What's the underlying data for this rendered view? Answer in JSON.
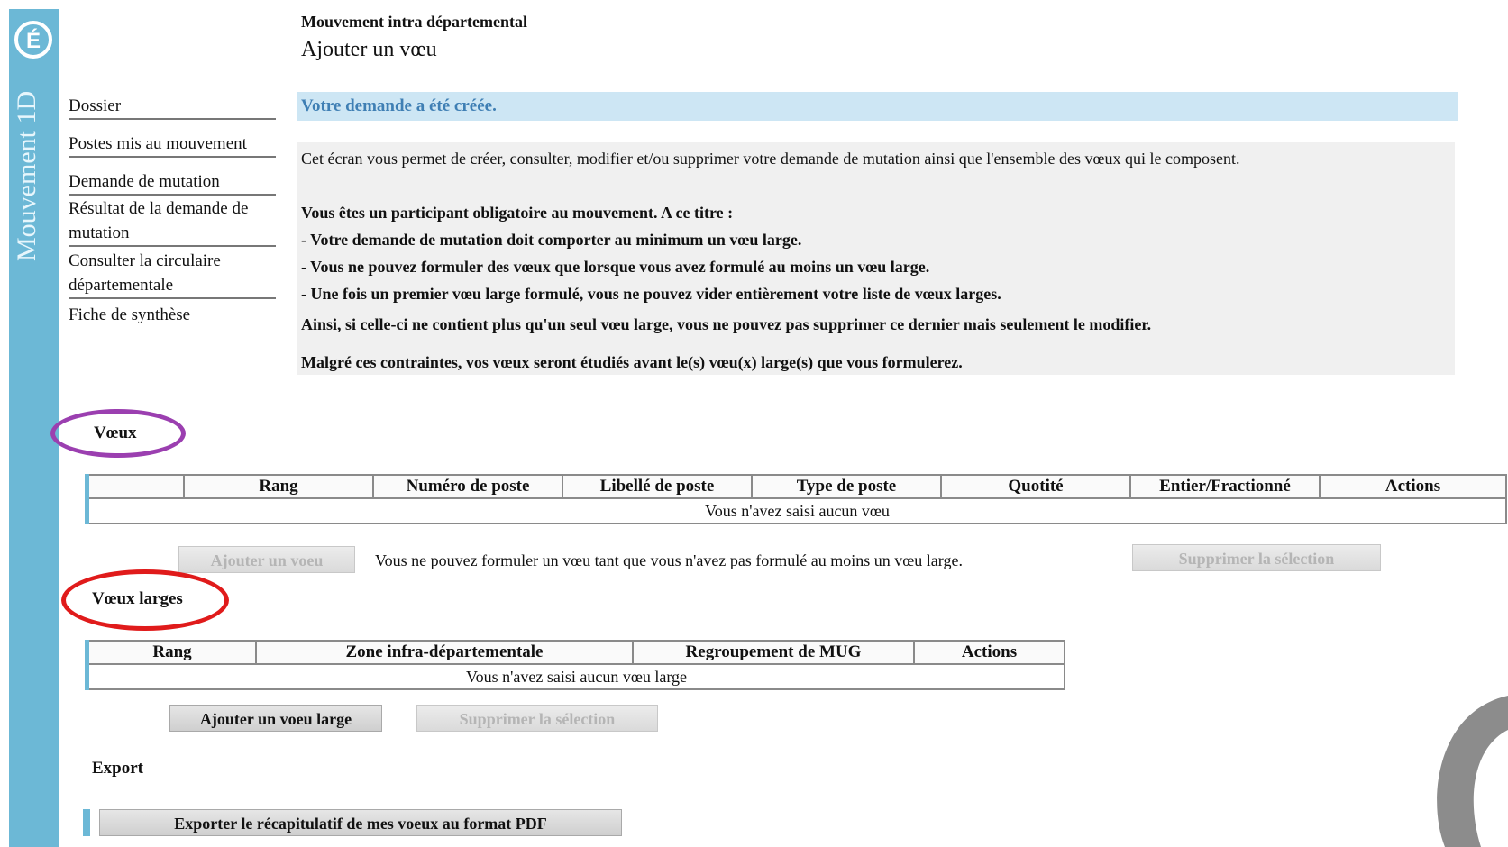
{
  "app": {
    "vertical_title": "Mouvement 1D",
    "logo_letter": "É"
  },
  "menu": {
    "items": [
      "Dossier",
      "Postes mis au mouvement",
      "Demande de mutation",
      "Résultat de la demande de mutation",
      "Consulter la circulaire départementale",
      "Fiche de synthèse"
    ]
  },
  "header": {
    "subtitle": "Mouvement intra départemental",
    "title": "Ajouter un vœu"
  },
  "success_message": "Votre demande a été créée.",
  "info": {
    "intro": "Cet écran vous permet de créer, consulter, modifier et/ou supprimer votre demande de mutation ainsi que l'ensemble des vœux qui le composent.",
    "lines": [
      "Vous êtes un participant obligatoire au mouvement. A ce titre :",
      " - Votre demande de mutation doit comporter au minimum un vœu large.",
      " - Vous ne pouvez formuler des vœux que lorsque vous avez formulé au moins un vœu large.",
      " - Une fois un premier vœu large formulé, vous ne pouvez vider entièrement votre liste de vœux larges.",
      "Ainsi, si celle-ci ne contient plus qu'un seul vœu large, vous ne pouvez pas supprimer ce dernier mais seulement le modifier.",
      "Malgré ces contraintes, vos vœux seront étudiés avant le(s) vœu(x) large(s) que vous formulerez."
    ]
  },
  "voeux": {
    "label": "Vœux",
    "headers": [
      "",
      "Rang",
      "Numéro de poste",
      "Libellé de poste",
      "Type de poste",
      "Quotité",
      "Entier/Fractionné",
      "Actions"
    ],
    "empty_text": "Vous n'avez saisi aucun vœu",
    "add_button": "Ajouter un voeu",
    "notice": "Vous ne pouvez formuler un vœu tant que vous n'avez pas formulé au moins un vœu large.",
    "delete_button": "Supprimer la sélection"
  },
  "voeux_larges": {
    "label": "Vœux larges",
    "headers": [
      "Rang",
      "Zone infra-départementale",
      "Regroupement de MUG",
      "Actions"
    ],
    "empty_text": "Vous n'avez saisi aucun vœu large",
    "add_button": "Ajouter un voeu large",
    "delete_button": "Supprimer la sélection"
  },
  "export": {
    "label": "Export",
    "button": "Exporter le récapitulatif de mes voeux au format PDF"
  },
  "colors": {
    "band": "#6cb8d6",
    "success_bg": "#cde6f4",
    "success_text": "#3f7fb4",
    "highlight_purple": "#9b3fb0",
    "highlight_red": "#e01b1b"
  }
}
